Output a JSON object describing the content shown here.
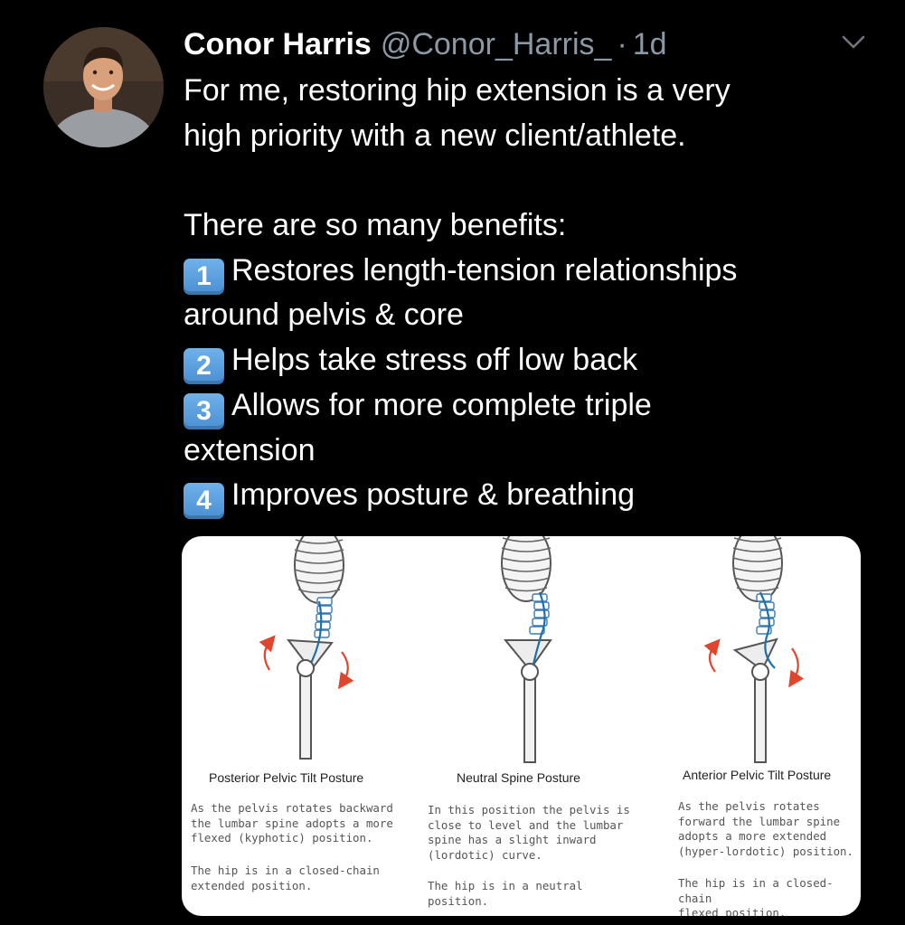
{
  "tweet": {
    "author_name": "Conor Harris",
    "handle": "@Conor_Harris_",
    "separator": "·",
    "timestamp": "1d",
    "body_lines": [
      {
        "text": "For me, restoring hip extension is a very"
      },
      {
        "text": "high priority with a new client/athlete."
      },
      {
        "text": ""
      },
      {
        "text": "There are so many benefits:"
      },
      {
        "badge": "1",
        "text": "Restores length-tension relationships"
      },
      {
        "text": "around pelvis & core"
      },
      {
        "badge": "2",
        "text": "Helps take stress off low back"
      },
      {
        "badge": "3",
        "text": "Allows for more complete triple"
      },
      {
        "text": "extension"
      },
      {
        "badge": "4",
        "text": "Improves posture & breathing"
      }
    ]
  },
  "icons": {
    "avatar": "profile-photo",
    "caret": "chevron-down-icon",
    "keycap": "keycap-digit-emoji"
  },
  "colors": {
    "background": "#000000",
    "name": "#ffffff",
    "meta": "#8b98a5",
    "keycap": "#5a9fdf",
    "arrow": "#e0462e",
    "spine": "#1f6fa8"
  },
  "media": {
    "panels": [
      {
        "title": "Posterior Pelvic Tilt Posture",
        "desc": "As the pelvis rotates backward\nthe lumbar spine adopts a more\nflexed (kyphotic) position.",
        "hip": "The hip is in a closed-chain\nextended position."
      },
      {
        "title": "Neutral Spine Posture",
        "desc": "In this position the pelvis is\nclose to level and the lumbar\nspine has a slight inward\n(lordotic) curve.",
        "hip": "The hip is in a neutral\nposition."
      },
      {
        "title": "Anterior Pelvic Tilt Posture",
        "desc": "As the pelvis rotates\nforward the lumbar spine\nadopts a more extended\n(hyper-lordotic) position.",
        "hip": "The hip is in a closed-chain\nflexed position."
      }
    ]
  }
}
